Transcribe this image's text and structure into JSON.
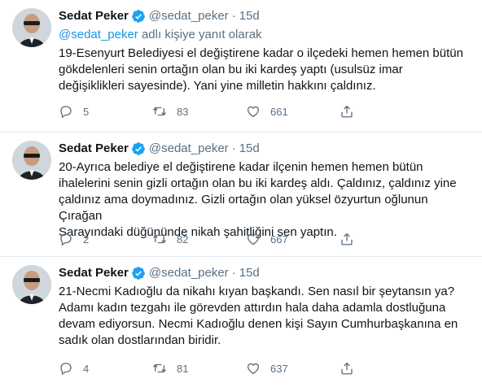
{
  "colors": {
    "accent": "#1b95e0",
    "secondary_text": "#5b7083",
    "divider": "#e6ecf0",
    "verified_badge": "#1da1f2"
  },
  "icons": {
    "verified": "verified-badge-icon",
    "reply": "reply-icon",
    "retweet": "retweet-icon",
    "like": "heart-icon",
    "share": "share-icon"
  },
  "tweets": [
    {
      "author_name": "Sedat Peker",
      "handle": "@sedat_peker",
      "separator": "·",
      "time": "15d",
      "reply_to_mention": "@sedat_peker",
      "reply_to_suffix": " adlı kişiye yanıt olarak",
      "text": "19-Esenyurt Belediyesi el değiştirene kadar o ilçedeki hemen hemen bütün\ngökdelenleri senin ortağın olan bu iki kardeş yaptı (usulsüz imar\ndeğişiklikleri sayesinde). Yani yine milletin hakkını çaldınız.",
      "replies": "5",
      "retweets": "83",
      "likes": "661"
    },
    {
      "author_name": "Sedat Peker",
      "handle": "@sedat_peker",
      "separator": "·",
      "time": "15d",
      "text": "20-Ayrıca belediye el değiştirene kadar ilçenin hemen hemen bütün\nihalelerini senin gizli ortağın olan bu iki kardeş aldı. Çaldınız, çaldınız yine\nçaldınız ama doymadınız. Gizli ortağın olan yüksel özyurtun oğlunun Çırağan\nSarayındaki düğününde nikah şahitliğini sen yaptın.",
      "replies": "2",
      "retweets": "82",
      "likes": "667"
    },
    {
      "author_name": "Sedat Peker",
      "handle": "@sedat_peker",
      "separator": "·",
      "time": "15d",
      "text": "21-Necmi Kadıoğlu da nikahı kıyan başkandı. Sen nasıl bir şeytansın ya?\nAdamı kadın tezgahı ile görevden attırdın hala daha adamla dostluğuna\ndevam ediyorsun. Necmi Kadıoğlu denen kişi Sayın Cumhurbaşkanına en\nsadık olan dostlarından biridir.",
      "replies": "4",
      "retweets": "81",
      "likes": "637"
    }
  ]
}
